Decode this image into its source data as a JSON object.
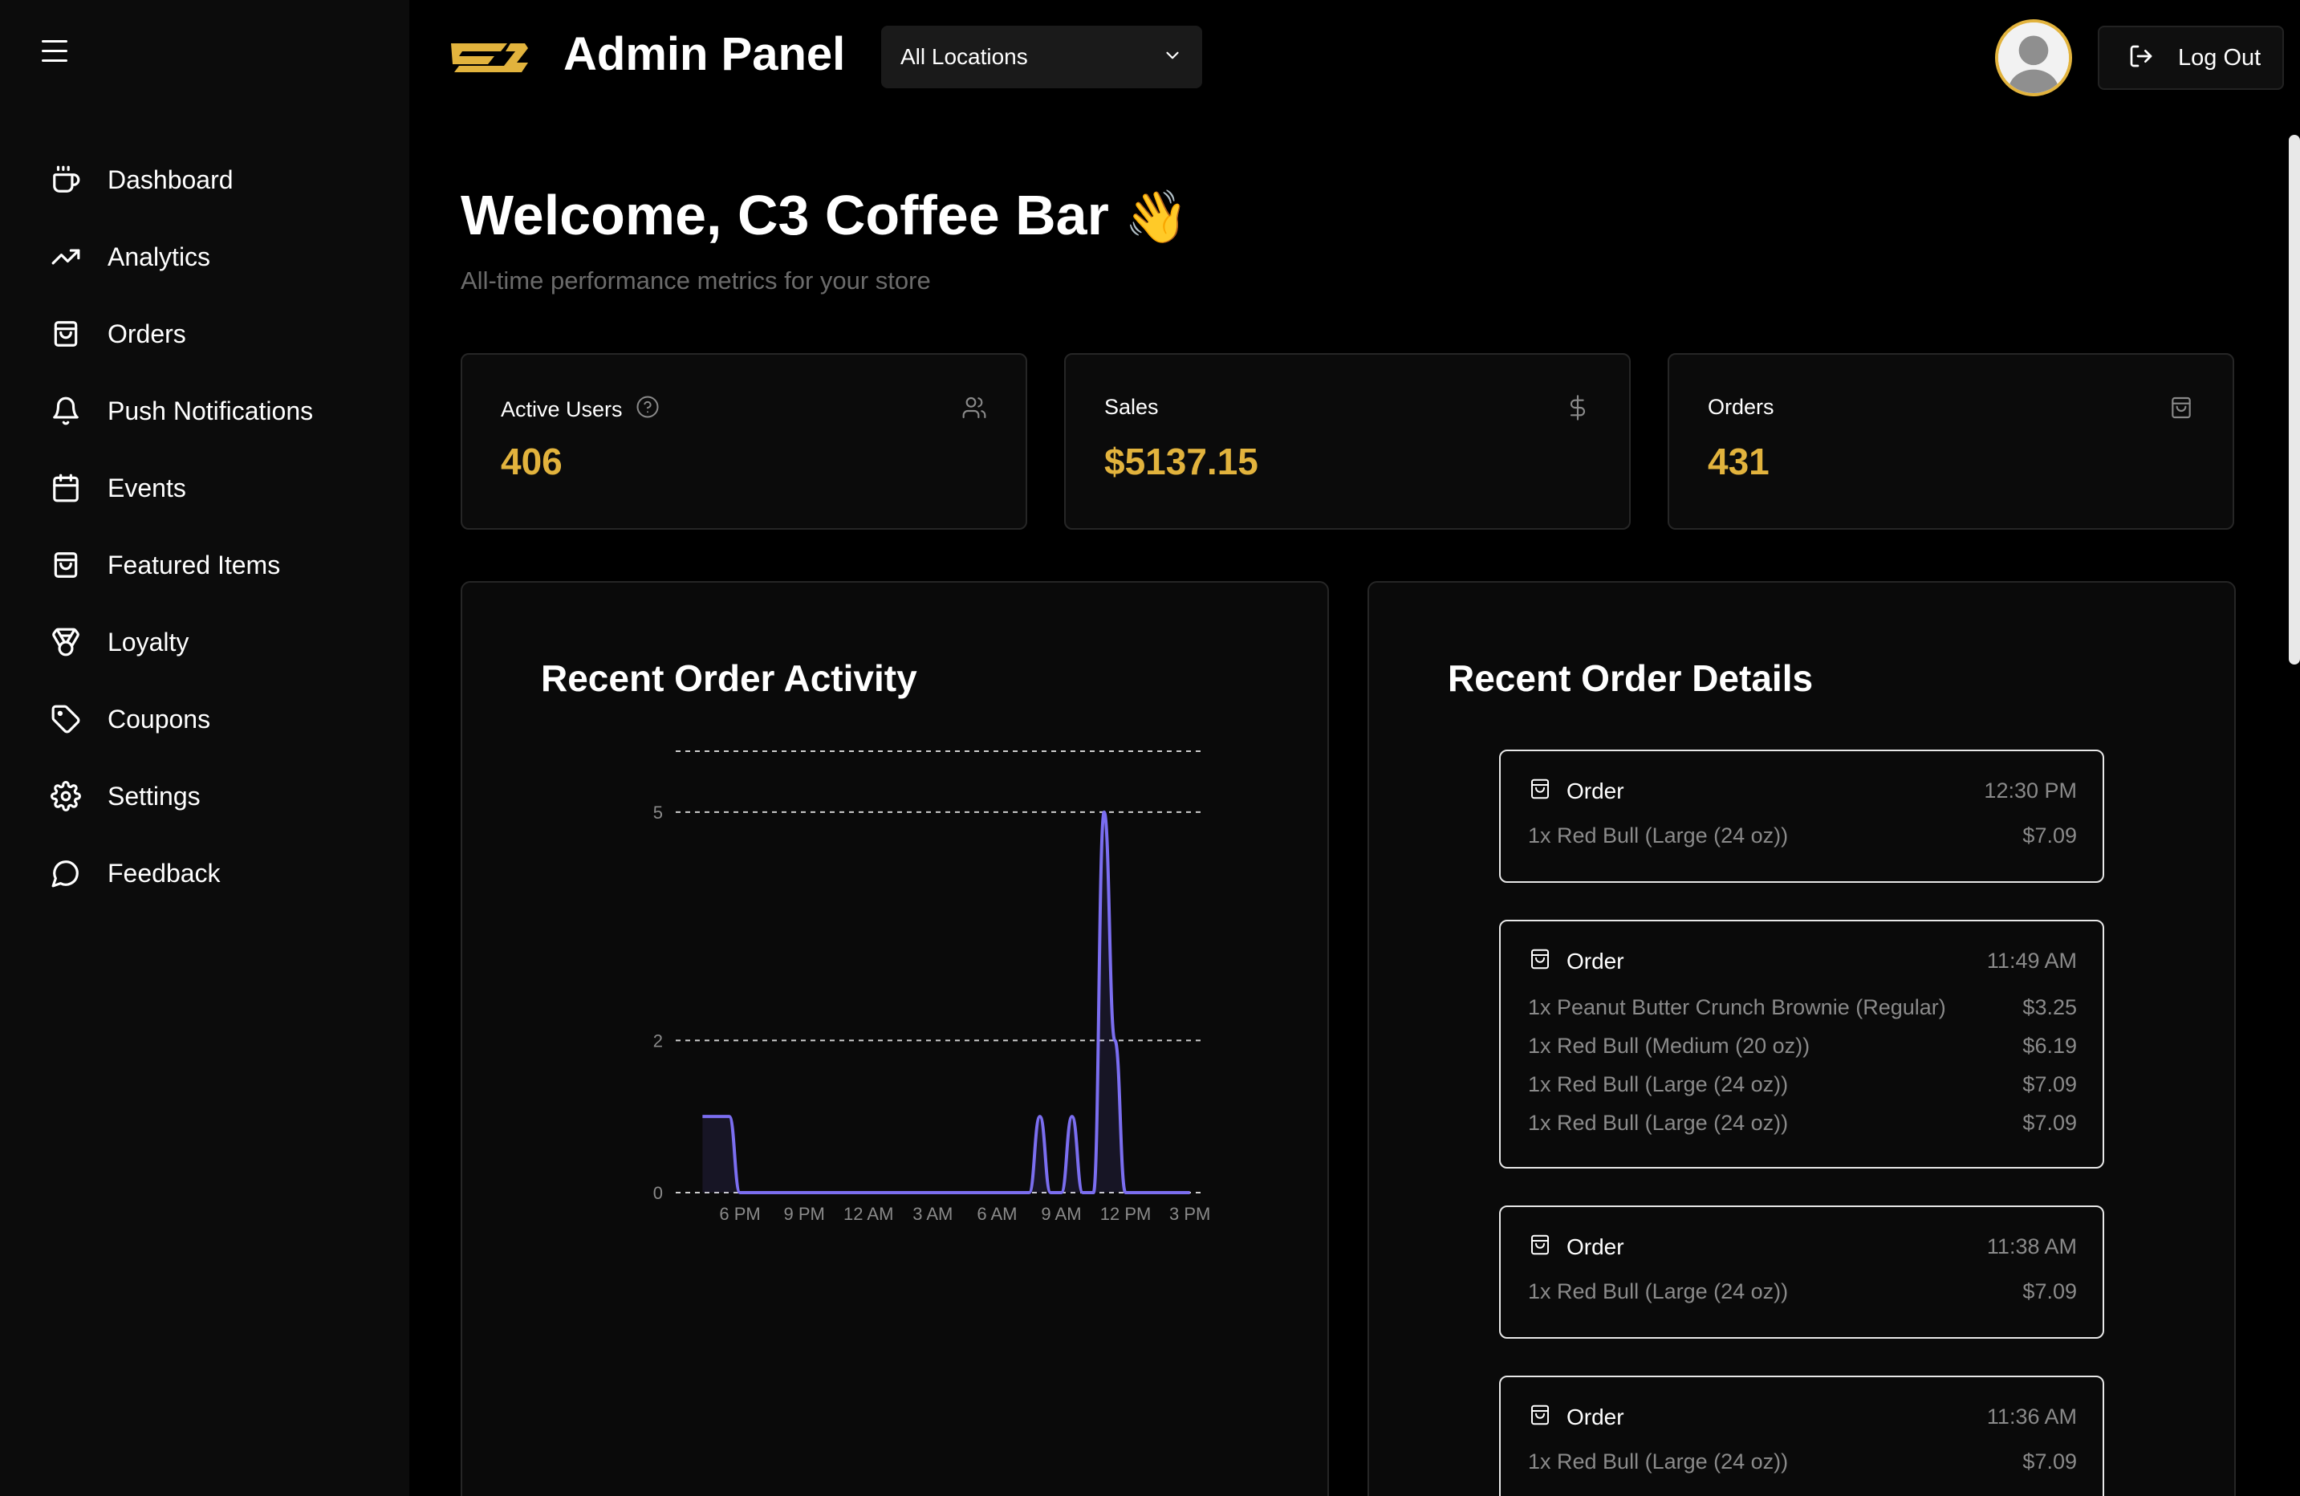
{
  "header": {
    "title": "Admin Panel",
    "location_select": {
      "value": "All Locations"
    },
    "logout_label": "Log Out",
    "brand_color": "#e2b33d"
  },
  "sidebar": {
    "items": [
      {
        "label": "Dashboard",
        "icon": "coffee-cup-icon"
      },
      {
        "label": "Analytics",
        "icon": "trending-up-icon"
      },
      {
        "label": "Orders",
        "icon": "shopping-bag-icon"
      },
      {
        "label": "Push Notifications",
        "icon": "bell-icon"
      },
      {
        "label": "Events",
        "icon": "calendar-icon"
      },
      {
        "label": "Featured Items",
        "icon": "shopping-bag-icon"
      },
      {
        "label": "Loyalty",
        "icon": "medal-icon"
      },
      {
        "label": "Coupons",
        "icon": "tag-icon"
      },
      {
        "label": "Settings",
        "icon": "gear-icon"
      },
      {
        "label": "Feedback",
        "icon": "message-circle-icon"
      }
    ]
  },
  "main": {
    "welcome": "Welcome, C3 Coffee Bar",
    "wave": "👋",
    "subtitle": "All-time performance metrics for your store",
    "stats": [
      {
        "label": "Active Users",
        "value": "406",
        "icon": "users-icon"
      },
      {
        "label": "Sales",
        "value": "$5137.15",
        "icon": "dollar-icon"
      },
      {
        "label": "Orders",
        "value": "431",
        "icon": "shopping-bag-icon"
      }
    ],
    "activity_title": "Recent Order Activity",
    "details_title": "Recent Order Details",
    "orders": [
      {
        "title": "Order",
        "time": "12:30 PM",
        "lines": [
          {
            "item": "1x Red Bull (Large (24 oz))",
            "price": "$7.09"
          }
        ]
      },
      {
        "title": "Order",
        "time": "11:49 AM",
        "lines": [
          {
            "item": "1x Peanut Butter Crunch Brownie (Regular)",
            "price": "$3.25"
          },
          {
            "item": "1x Red Bull (Medium (20 oz))",
            "price": "$6.19"
          },
          {
            "item": "1x Red Bull (Large (24 oz))",
            "price": "$7.09"
          },
          {
            "item": "1x Red Bull (Large (24 oz))",
            "price": "$7.09"
          }
        ]
      },
      {
        "title": "Order",
        "time": "11:38 AM",
        "lines": [
          {
            "item": "1x Red Bull (Large (24 oz))",
            "price": "$7.09"
          }
        ]
      },
      {
        "title": "Order",
        "time": "11:36 AM",
        "lines": [
          {
            "item": "1x Red Bull (Large (24 oz))",
            "price": "$7.09"
          }
        ]
      }
    ]
  },
  "chart_data": {
    "type": "line",
    "title": "Recent Order Activity",
    "xlabel": "",
    "ylabel": "",
    "x_ticks": [
      "6 PM",
      "9 PM",
      "12 AM",
      "3 AM",
      "6 AM",
      "9 AM",
      "12 PM",
      "3 PM"
    ],
    "y_ticks": [
      0,
      2,
      5
    ],
    "ylim": [
      0,
      5.8
    ],
    "grid": true,
    "line_color": "#7b6ef0",
    "x": [
      16.25,
      17,
      17.5,
      18,
      21,
      24,
      27,
      30,
      31,
      31.5,
      32,
      32.5,
      33,
      33.5,
      34,
      34.5,
      35,
      35.5,
      36,
      36.5,
      37,
      37.5,
      38,
      38.5,
      39
    ],
    "values": [
      1,
      1,
      1,
      0,
      0,
      0,
      0,
      0,
      0,
      0,
      1,
      0,
      0,
      1,
      0,
      0,
      5,
      2,
      0,
      0,
      0,
      0,
      0,
      0,
      0
    ]
  }
}
